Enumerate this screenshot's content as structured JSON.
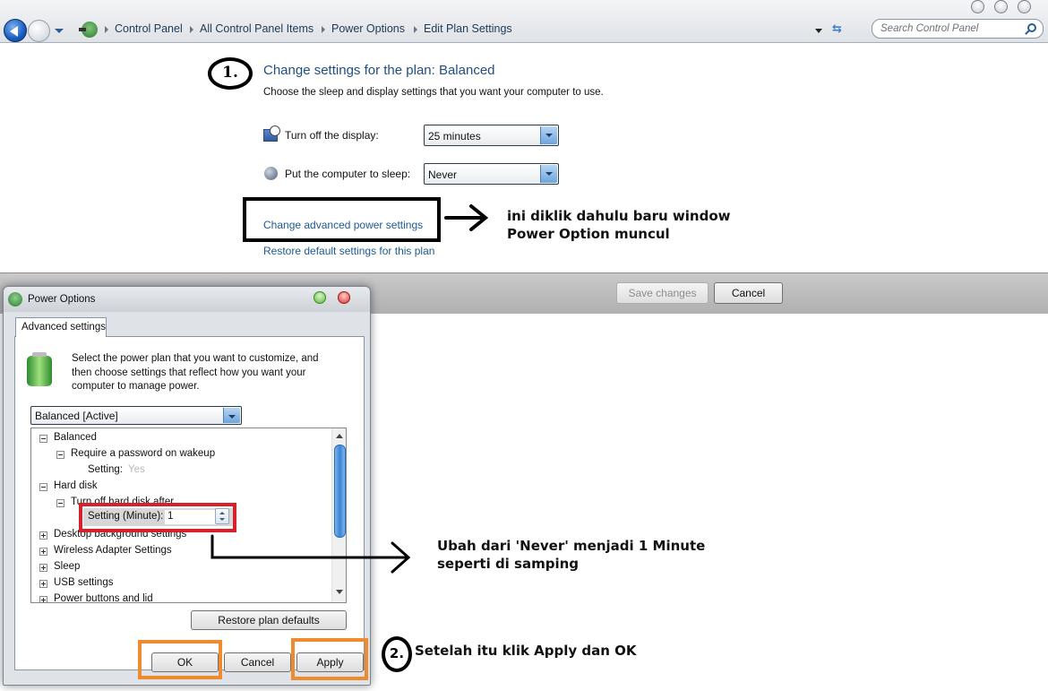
{
  "explorer": {
    "breadcrumb": [
      "Control Panel",
      "All Control Panel Items",
      "Power Options",
      "Edit Plan Settings"
    ],
    "search_placeholder": "Search Control Panel"
  },
  "plan_settings": {
    "heading": "Change settings for the plan: Balanced",
    "subheading": "Choose the sleep and display settings that you want your computer to use.",
    "display_label": "Turn off the display:",
    "display_value": "25 minutes",
    "sleep_label": "Put the computer to sleep:",
    "sleep_value": "Never",
    "advanced_link": "Change advanced power settings",
    "restore_link": "Restore default settings for this plan",
    "save_button": "Save changes",
    "cancel_button": "Cancel"
  },
  "dialog": {
    "title": "Power Options",
    "tab": "Advanced settings",
    "intro": "Select the power plan that you want to customize, and then choose settings that reflect how you want your computer to manage power.",
    "plan_select": "Balanced [Active]",
    "tree": {
      "balanced": "Balanced",
      "require_password": "Require a password on wakeup",
      "setting_label": "Setting:",
      "setting_value": "Yes",
      "hard_disk": "Hard disk",
      "turn_off_disk": "Turn off hard disk after",
      "minute_label": "Setting (Minute):",
      "minute_value": "1",
      "desktop_bg": "Desktop background settings",
      "wireless": "Wireless Adapter Settings",
      "sleep": "Sleep",
      "usb": "USB settings",
      "power_buttons": "Power buttons and lid"
    },
    "restore_button": "Restore plan defaults",
    "ok_button": "OK",
    "cancel_button": "Cancel",
    "apply_button": "Apply"
  },
  "annotations": {
    "step0_line1": "ini diklik dahulu baru window",
    "step0_line2": "Power Option muncul",
    "step1_marker": "1.",
    "step1_line1": "Ubah dari 'Never' menjadi 1 Minute",
    "step1_line2": "seperti di samping",
    "step2_marker": "2.",
    "step2_text": "Setelah itu klik Apply dan OK"
  }
}
